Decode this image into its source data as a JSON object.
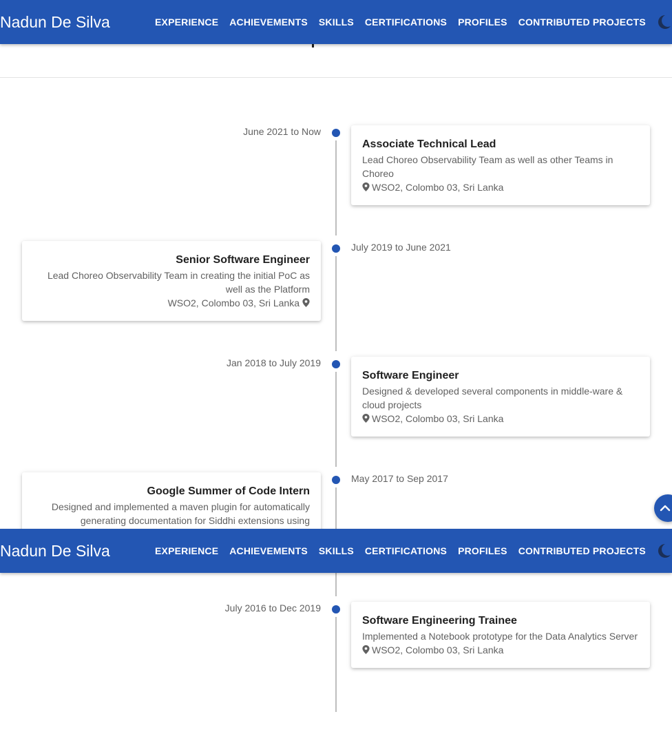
{
  "nav": {
    "brand": "Nadun De Silva",
    "items": [
      "EXPERIENCE",
      "ACHIEVEMENTS",
      "SKILLS",
      "CERTIFICATIONS",
      "PROFILES",
      "CONTRIBUTED PROJECTS"
    ],
    "theme_icon": "moon-icon"
  },
  "timeline": [
    {
      "date": "June 2021 to Now",
      "title": "Associate Technical Lead",
      "description": "Lead Choreo Observability Team as well as other Teams in Choreo",
      "location": "WSO2, Colombo 03, Sri Lanka"
    },
    {
      "date": "July 2019 to June 2021",
      "title": "Senior Software Engineer",
      "description": "Lead Choreo Observability Team in creating the initial PoC as well as the Platform",
      "location": "WSO2, Colombo 03, Sri Lanka"
    },
    {
      "date": "Jan 2018 to July 2019",
      "title": "Software Engineer",
      "description": "Designed & developed several components in middle-ware & cloud projects",
      "location": "WSO2, Colombo 03, Sri Lanka"
    },
    {
      "date": "May 2017 to Sep 2017",
      "title": "Google Summer of Code Intern",
      "description": "Designed and implemented a maven plugin for automatically generating documentation for Siddhi extensions using"
    },
    {
      "date": "July 2016 to Dec 2019",
      "title": "Software Engineering Trainee",
      "description": "Implemented a Notebook prototype for the Data Analytics Server",
      "location": "WSO2, Colombo 03, Sri Lanka"
    }
  ],
  "icons": {
    "location": "map-marker-icon",
    "scroll_top": "chevron-up-icon"
  },
  "colors": {
    "primary": "#2356b3",
    "text_secondary": "#616161",
    "line": "#bdbdbd"
  }
}
